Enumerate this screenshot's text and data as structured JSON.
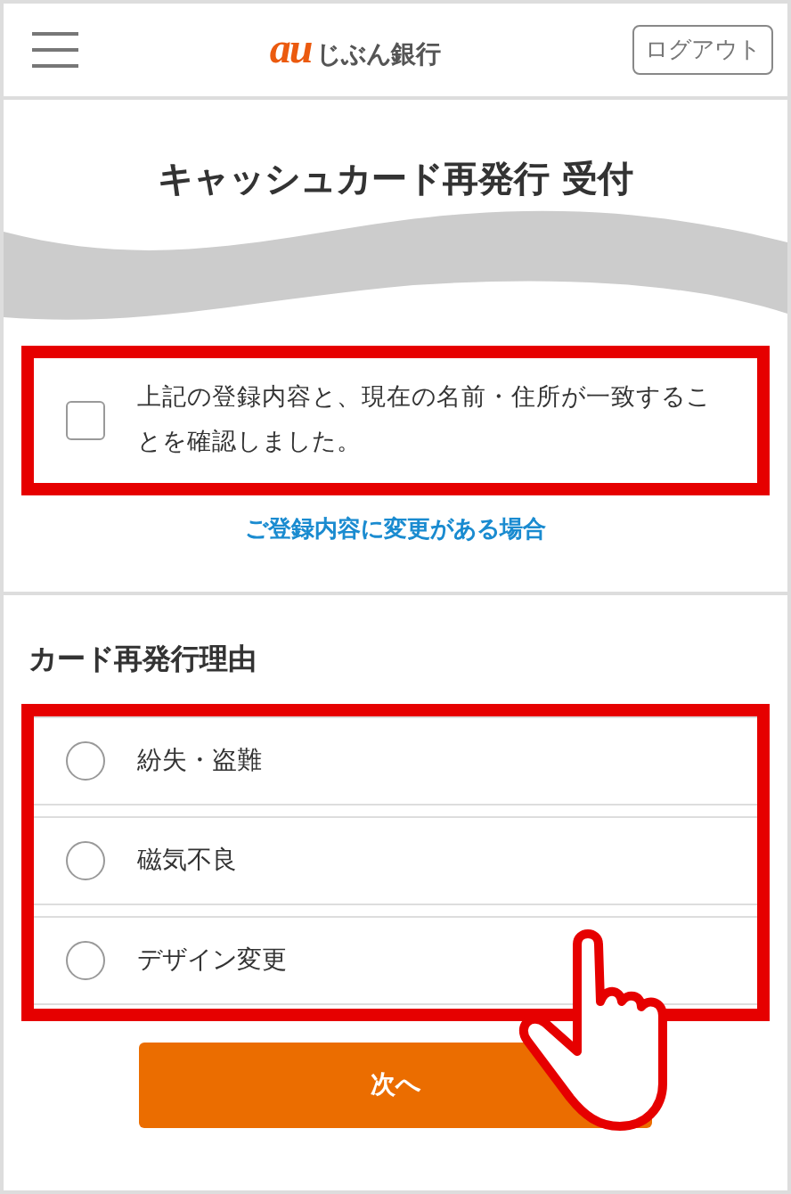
{
  "header": {
    "logo": {
      "brand": "au",
      "name": "じぶん銀行"
    },
    "logout_button": "ログアウト"
  },
  "title": "キャッシュカード再発行 受付",
  "confirmation": {
    "label": "上記の登録内容と、現在の名前・住所が一致することを確認しました。",
    "checked": false
  },
  "change_link": "ご登録内容に変更がある場合",
  "reason_section": {
    "heading": "カード再発行理由",
    "options": [
      {
        "label": "紛失・盗難",
        "selected": false
      },
      {
        "label": "磁気不良",
        "selected": false
      },
      {
        "label": "デザイン変更",
        "selected": false
      }
    ]
  },
  "next_button": "次へ"
}
